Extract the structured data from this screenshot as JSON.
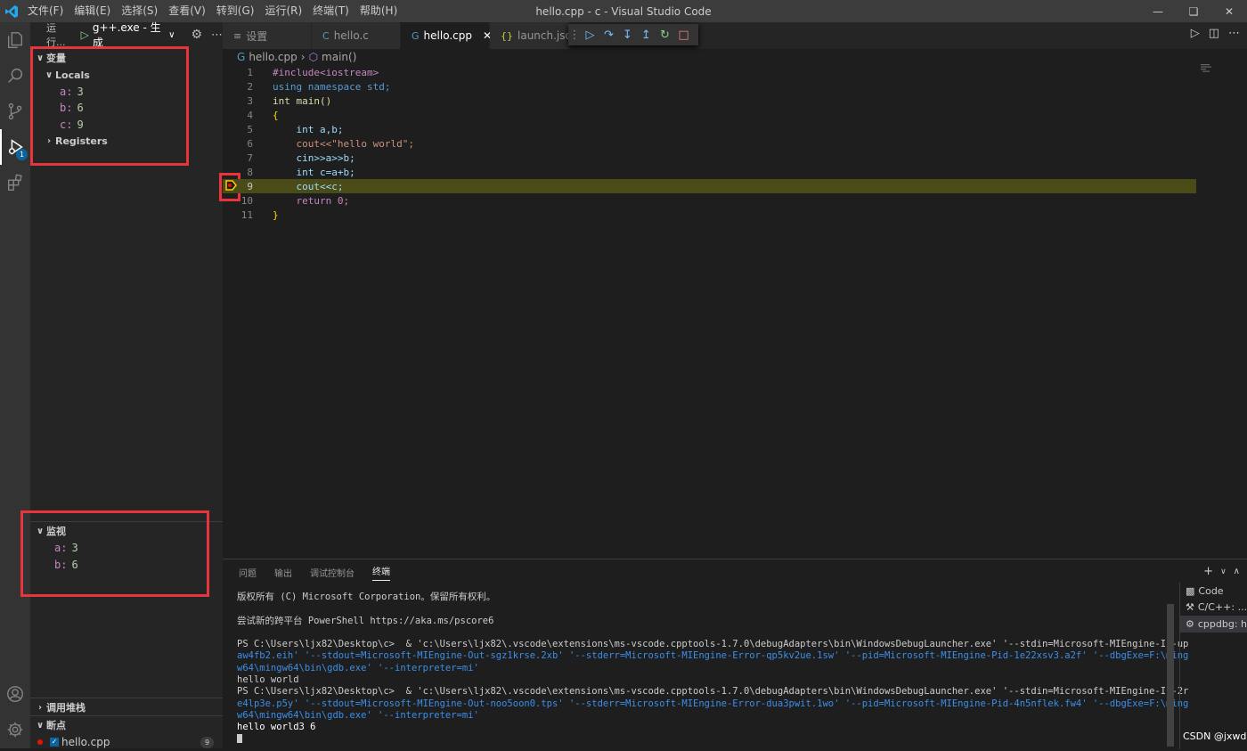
{
  "title_bar": {
    "menu": [
      "文件(F)",
      "编辑(E)",
      "选择(S)",
      "查看(V)",
      "转到(G)",
      "运行(R)",
      "终端(T)",
      "帮助(H)"
    ],
    "window_title": "hello.cpp - c - Visual Studio Code"
  },
  "activity_bar": {
    "debug_badge": "1"
  },
  "sidebar": {
    "run_label": "运行...",
    "config_label": "g++.exe - 生成",
    "variables": {
      "header": "变量",
      "locals_label": "Locals",
      "locals": [
        {
          "name": "a:",
          "value": "3"
        },
        {
          "name": "b:",
          "value": "6"
        },
        {
          "name": "c:",
          "value": "9"
        }
      ],
      "registers_label": "Registers"
    },
    "watch": {
      "header": "监视",
      "items": [
        {
          "name": "a:",
          "value": "3"
        },
        {
          "name": "b:",
          "value": "6"
        }
      ]
    },
    "call_stack_header": "调用堆栈",
    "breakpoints": {
      "header": "断点",
      "file": "hello.cpp",
      "count": "9"
    }
  },
  "tabs": [
    {
      "label": "设置",
      "icon": "settings-file-icon"
    },
    {
      "label": "hello.c",
      "icon": "c-file-icon"
    },
    {
      "label": "hello.cpp",
      "icon": "cpp-file-icon",
      "active": true
    },
    {
      "label": "launch.json",
      "icon": "json-file-icon"
    }
  ],
  "breadcrumb": {
    "file": "hello.cpp",
    "symbol": "main()"
  },
  "editor": {
    "current_line": 9,
    "line_numbers": [
      "1",
      "2",
      "3",
      "4",
      "5",
      "6",
      "7",
      "8",
      "9",
      "10",
      "11"
    ],
    "lines": [
      "#include<iostream>",
      "using namespace std;",
      "int main()",
      "{",
      "    int a,b;",
      "    cout<<\"hello world\";",
      "    cin>>a>>b;",
      "    int c=a+b;",
      "    cout<<c;",
      "    return 0;",
      "}"
    ]
  },
  "panel": {
    "tabs": [
      "问题",
      "输出",
      "调试控制台",
      "终端"
    ],
    "active_tab": "终端",
    "terminal_lines": [
      "版权所有 (C) Microsoft Corporation。保留所有权利。",
      "",
      "尝试新的跨平台 PowerShell https://aka.ms/pscore6",
      "",
      "PS C:\\Users\\ljx82\\Desktop\\c>  & 'c:\\Users\\ljx82\\.vscode\\extensions\\ms-vscode.cpptools-1.7.0\\debugAdapters\\bin\\WindowsDebugLauncher.exe' '--stdin=Microsoft-MIEngine-In-up",
      "aw4fb2.eih' '--stdout=Microsoft-MIEngine-Out-sgz1krse.2xb' '--stderr=Microsoft-MIEngine-Error-qp5kv2ue.1sw' '--pid=Microsoft-MIEngine-Pid-1e22xsv3.a2f' '--dbgExe=F:\\ming",
      "w64\\mingw64\\bin\\gdb.exe' '--interpreter=mi'",
      "hello world",
      "PS C:\\Users\\ljx82\\Desktop\\c>  & 'c:\\Users\\ljx82\\.vscode\\extensions\\ms-vscode.cpptools-1.7.0\\debugAdapters\\bin\\WindowsDebugLauncher.exe' '--stdin=Microsoft-MIEngine-In-2r",
      "e4lp3e.p5y' '--stdout=Microsoft-MIEngine-Out-noo5oon0.tps' '--stderr=Microsoft-MIEngine-Error-dua3pwit.1wo' '--pid=Microsoft-MIEngine-Pid-4n5nflek.fw4' '--dbgExe=F:\\ming",
      "w64\\mingw64\\bin\\gdb.exe' '--interpreter=mi'",
      "hello world3 6"
    ],
    "terminals": [
      "Code",
      "C/C++: ...",
      "cppdbg: he"
    ]
  },
  "watermark": "CSDN @jxwd"
}
